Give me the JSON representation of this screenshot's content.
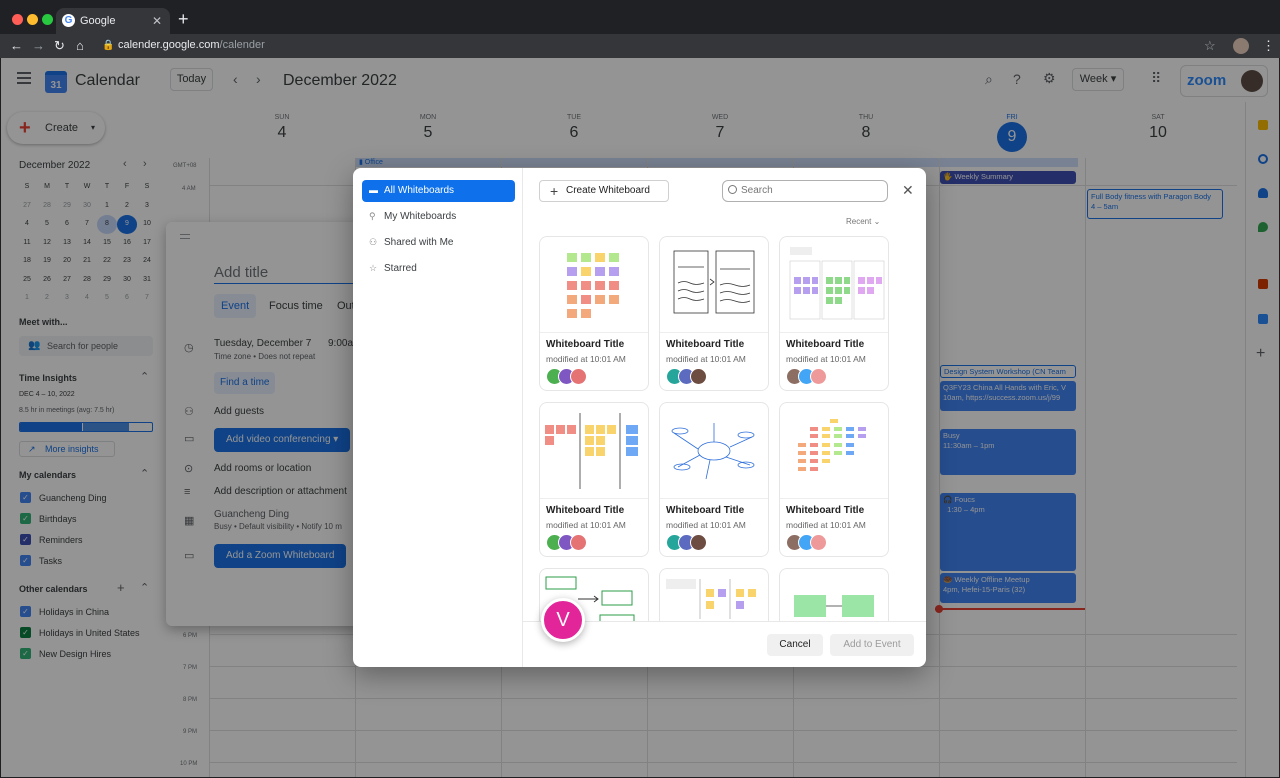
{
  "browser": {
    "tab_title": "Google",
    "url_host": "calender.google.com",
    "url_path": "/calender"
  },
  "header": {
    "app_title": "Calendar",
    "today": "Today",
    "month": "December 2022",
    "view": "Week"
  },
  "sidebar": {
    "create": "Create",
    "mini_month": "December 2022",
    "weekdays": [
      "S",
      "M",
      "T",
      "W",
      "T",
      "F",
      "S"
    ],
    "days": [
      "27",
      "28",
      "29",
      "30",
      "1",
      "2",
      "3",
      "4",
      "5",
      "6",
      "7",
      "8",
      "9",
      "10",
      "11",
      "12",
      "13",
      "14",
      "15",
      "16",
      "17",
      "18",
      "19",
      "20",
      "21",
      "22",
      "23",
      "24",
      "25",
      "26",
      "27",
      "28",
      "29",
      "30",
      "31",
      "1",
      "2",
      "3",
      "4",
      "5",
      "6",
      "7"
    ],
    "meet_with": "Meet with...",
    "search_people": "Search for people",
    "time_insights": "Time Insights",
    "insights_range": "DEC 4 – 10, 2022",
    "insights_hours": "8.5 hr in meetings (avg: 7.5 hr)",
    "more_insights": "More insights",
    "my_calendars": "My calendars",
    "my_items": [
      "Guancheng Ding",
      "Birthdays",
      "Reminders",
      "Tasks"
    ],
    "other_calendars": "Other calendars",
    "other_items": [
      "Holidays in China",
      "Holidays in United States",
      "New Design Hires"
    ],
    "colors": {
      "blue": "#4285f4",
      "green": "#33b679",
      "navy": "#3f51b5"
    }
  },
  "week": {
    "days": [
      {
        "name": "SUN",
        "num": "4"
      },
      {
        "name": "MON",
        "num": "5"
      },
      {
        "name": "TUE",
        "num": "6"
      },
      {
        "name": "WED",
        "num": "7"
      },
      {
        "name": "THU",
        "num": "8"
      },
      {
        "name": "FRI",
        "num": "9"
      },
      {
        "name": "SAT",
        "num": "10"
      }
    ],
    "tz": "GMT+08",
    "times": [
      "4 AM",
      "6 PM",
      "7 PM",
      "8 PM",
      "9 PM",
      "10 PM"
    ],
    "office": "Office",
    "events": {
      "weekly_summary": "Weekly Summary",
      "fullbody_title": "Full Body fitness with Paragon Body",
      "fullbody_time": "4 – 5am",
      "design_workshop": "Design System Workshop (CN Team",
      "q3fy23_title": "Q3FY23 China All Hands with Eric, V",
      "q3fy23_time": "10am, https://success.zoom.us/j/99",
      "busy_title": "Busy",
      "busy_time": "11:30am – 1pm",
      "focus_title": "Foucs",
      "focus_time": "1:30 – 4pm",
      "offline_title": "Weekly Offline Meetup",
      "offline_time": "4pm, Hefei-15-Paris (32)"
    }
  },
  "event_dialog": {
    "add_title": "Add title",
    "tab_event": "Event",
    "tab_focus": "Focus time",
    "tab_out": "Out",
    "date": "Tuesday, December 7",
    "time": "9:00a",
    "tz_note": "Time zone • Does not repeat",
    "find_time": "Find a time",
    "add_guests": "Add guests",
    "video": "Add video conferencing",
    "rooms": "Add rooms or location",
    "description": "Add  description or attachment",
    "owner": "Guancheng Ding",
    "owner_note": "Busy • Default visibility • Notify 10 m",
    "add_wb": "Add a Zoom Whiteboard"
  },
  "modal": {
    "nav": [
      "All Whiteboards",
      "My Whiteboards",
      "Shared with Me",
      "Starred"
    ],
    "create_wb": "Create Whiteboard",
    "search_placeholder": "Search",
    "sort": "Recent",
    "card_title": "Whiteboard Title",
    "card_meta": "modified at 10:01 AM",
    "cancel": "Cancel",
    "add_to_event": "Add to Event",
    "brand_blue": "#0e71eb"
  },
  "badge": "V"
}
